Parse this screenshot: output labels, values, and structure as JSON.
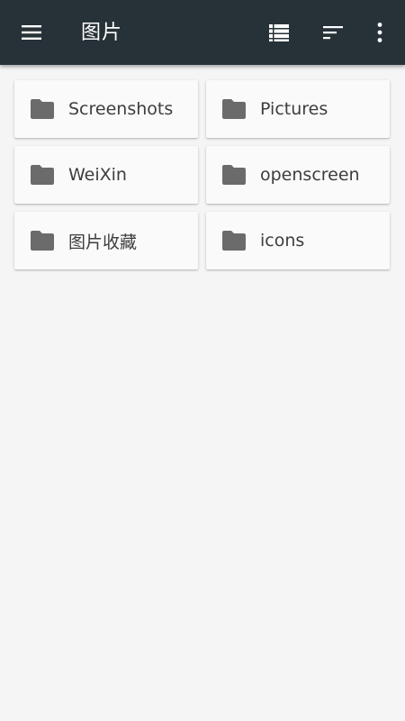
{
  "toolbar": {
    "title": "图片",
    "menu_icon": "menu-icon",
    "view_icon": "list-view-icon",
    "sort_icon": "sort-icon",
    "more_icon": "more-vert-icon",
    "background_color": "#263238"
  },
  "folders": [
    {
      "name": "Screenshots",
      "icon": "folder-icon"
    },
    {
      "name": "Pictures",
      "icon": "folder-icon"
    },
    {
      "name": "WeiXin",
      "icon": "folder-icon"
    },
    {
      "name": "openscreen",
      "icon": "folder-icon"
    },
    {
      "name": "图片收藏",
      "icon": "folder-icon"
    },
    {
      "name": "icons",
      "icon": "folder-icon"
    }
  ],
  "colors": {
    "background": "#f5f5f5",
    "card": "#fafafa",
    "folder_icon": "#6b6b6b",
    "text": "#3d3d3d"
  }
}
